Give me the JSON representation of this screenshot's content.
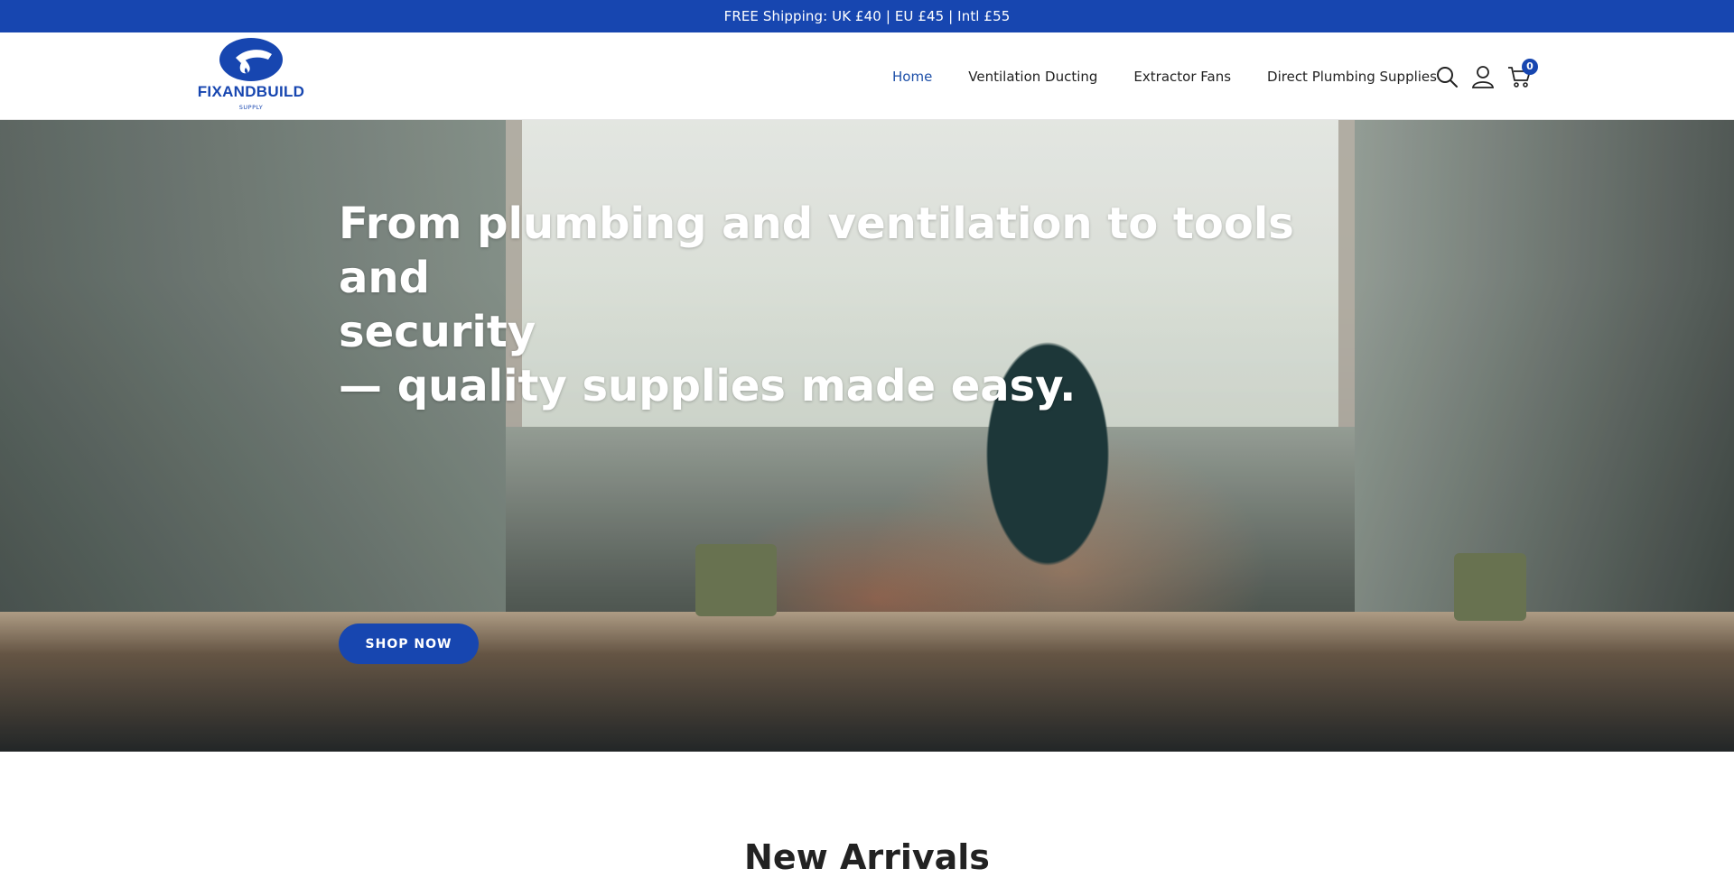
{
  "announcement": {
    "text": "FREE Shipping: UK £40 | EU £45 | Intl £55"
  },
  "header": {
    "logo": {
      "name": "FIXANDBUILD",
      "sub": "SUPPLY"
    },
    "nav": [
      {
        "label": "Home",
        "active": true
      },
      {
        "label": "Ventilation Ducting",
        "active": false
      },
      {
        "label": "Extractor Fans",
        "active": false
      },
      {
        "label": "Direct Plumbing Supplies",
        "active": false
      }
    ],
    "icons": [
      "search-icon",
      "account-icon",
      "cart-icon"
    ],
    "cart_count": "0"
  },
  "hero": {
    "title_lines": [
      "From plumbing and ventilation to tools and",
      "security",
      "— quality supplies made easy."
    ],
    "cta_label": "SHOP NOW"
  },
  "section": {
    "title": "New Arrivals"
  },
  "colors": {
    "brand": "#1746b0",
    "nav_active": "#1d4fa8",
    "text": "#222222"
  }
}
